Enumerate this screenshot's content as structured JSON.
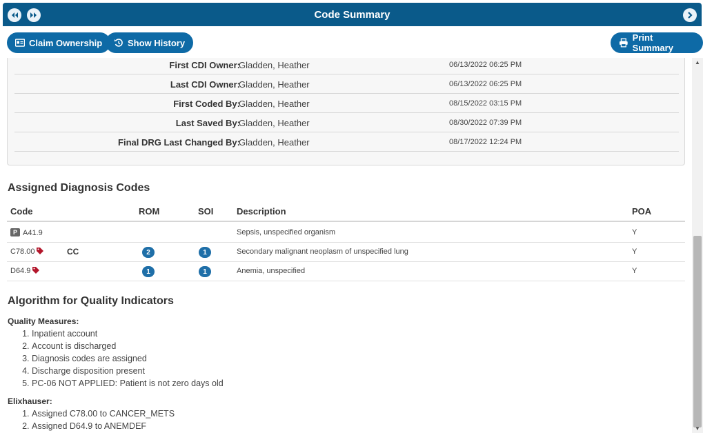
{
  "window": {
    "title": "Code Summary",
    "nav_prev_icon": "double-chevron-left-icon",
    "nav_next_icon": "double-chevron-right-icon",
    "forward_icon": "chevron-right-icon",
    "accent": "#0a5a8a"
  },
  "toolbar": {
    "claim_ownership": "Claim Ownership",
    "show_history": "Show History",
    "print_summary": "Print Summary"
  },
  "owners": [
    {
      "label": "First CDI Owner:",
      "name": "Gladden, Heather",
      "date": "06/13/2022 06:25 PM"
    },
    {
      "label": "Last CDI Owner:",
      "name": "Gladden, Heather",
      "date": "06/13/2022 06:25 PM"
    },
    {
      "label": "First Coded By:",
      "name": "Gladden, Heather",
      "date": "08/15/2022 03:15 PM"
    },
    {
      "label": "Last Saved By:",
      "name": "Gladden, Heather",
      "date": "08/30/2022 07:39 PM"
    },
    {
      "label": "Final DRG Last Changed By:",
      "name": "Gladden, Heather",
      "date": "08/17/2022 12:24 PM"
    }
  ],
  "diagnosis": {
    "heading": "Assigned Diagnosis Codes",
    "columns": {
      "code": "Code",
      "rom": "ROM",
      "soi": "SOI",
      "description": "Description",
      "poa": "POA"
    },
    "rows": [
      {
        "principal_badge": "P",
        "code": "A41.9",
        "cc": "",
        "rom": "",
        "soi": "",
        "description": "Sepsis, unspecified organism",
        "poa": "Y"
      },
      {
        "principal_badge": "",
        "code": "C78.00",
        "cc": "CC",
        "rom": "2",
        "soi": "1",
        "description": "Secondary malignant neoplasm of unspecified lung",
        "poa": "Y"
      },
      {
        "principal_badge": "",
        "code": "D64.9",
        "cc": "",
        "rom": "1",
        "soi": "1",
        "description": "Anemia, unspecified",
        "poa": "Y"
      }
    ]
  },
  "quality": {
    "heading": "Algorithm for Quality Indicators",
    "measures_title": "Quality Measures:",
    "measures": [
      "Inpatient account",
      "Account is discharged",
      "Diagnosis codes are assigned",
      "Discharge disposition present",
      "PC-06 NOT APPLIED: Patient is not zero days old"
    ],
    "elix_title": "Elixhauser:",
    "elix": [
      "Assigned C78.00 to CANCER_METS",
      "Assigned D64.9 to ANEMDEF"
    ]
  }
}
